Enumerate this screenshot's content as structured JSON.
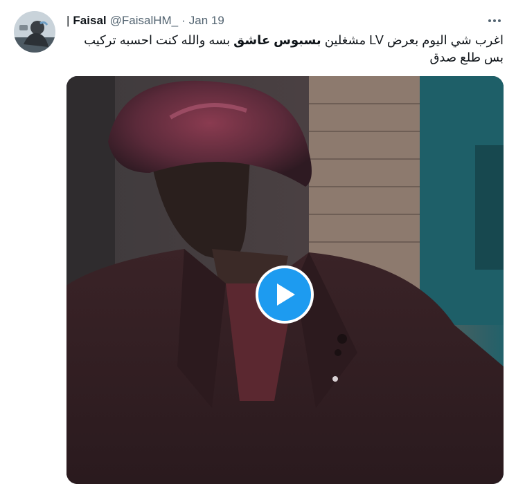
{
  "tweet": {
    "name_prefix": "|",
    "display_name": "Faisal",
    "handle": "@FaisalHM_",
    "separator": "·",
    "date": "Jan 19",
    "more_icon": "more-horizontal-icon",
    "text_part1": "اغرب شي اليوم بعرض LV مشغلين ",
    "text_bold": "بسبوس عاشق",
    "text_part2": " بسه والله كنت احسبه تركيب بس طلع صدق",
    "media": {
      "type": "video",
      "play_icon": "play-icon"
    }
  },
  "colors": {
    "accent": "#1d9bf0",
    "secondary_text": "#536471",
    "primary_text": "#0f1419"
  }
}
